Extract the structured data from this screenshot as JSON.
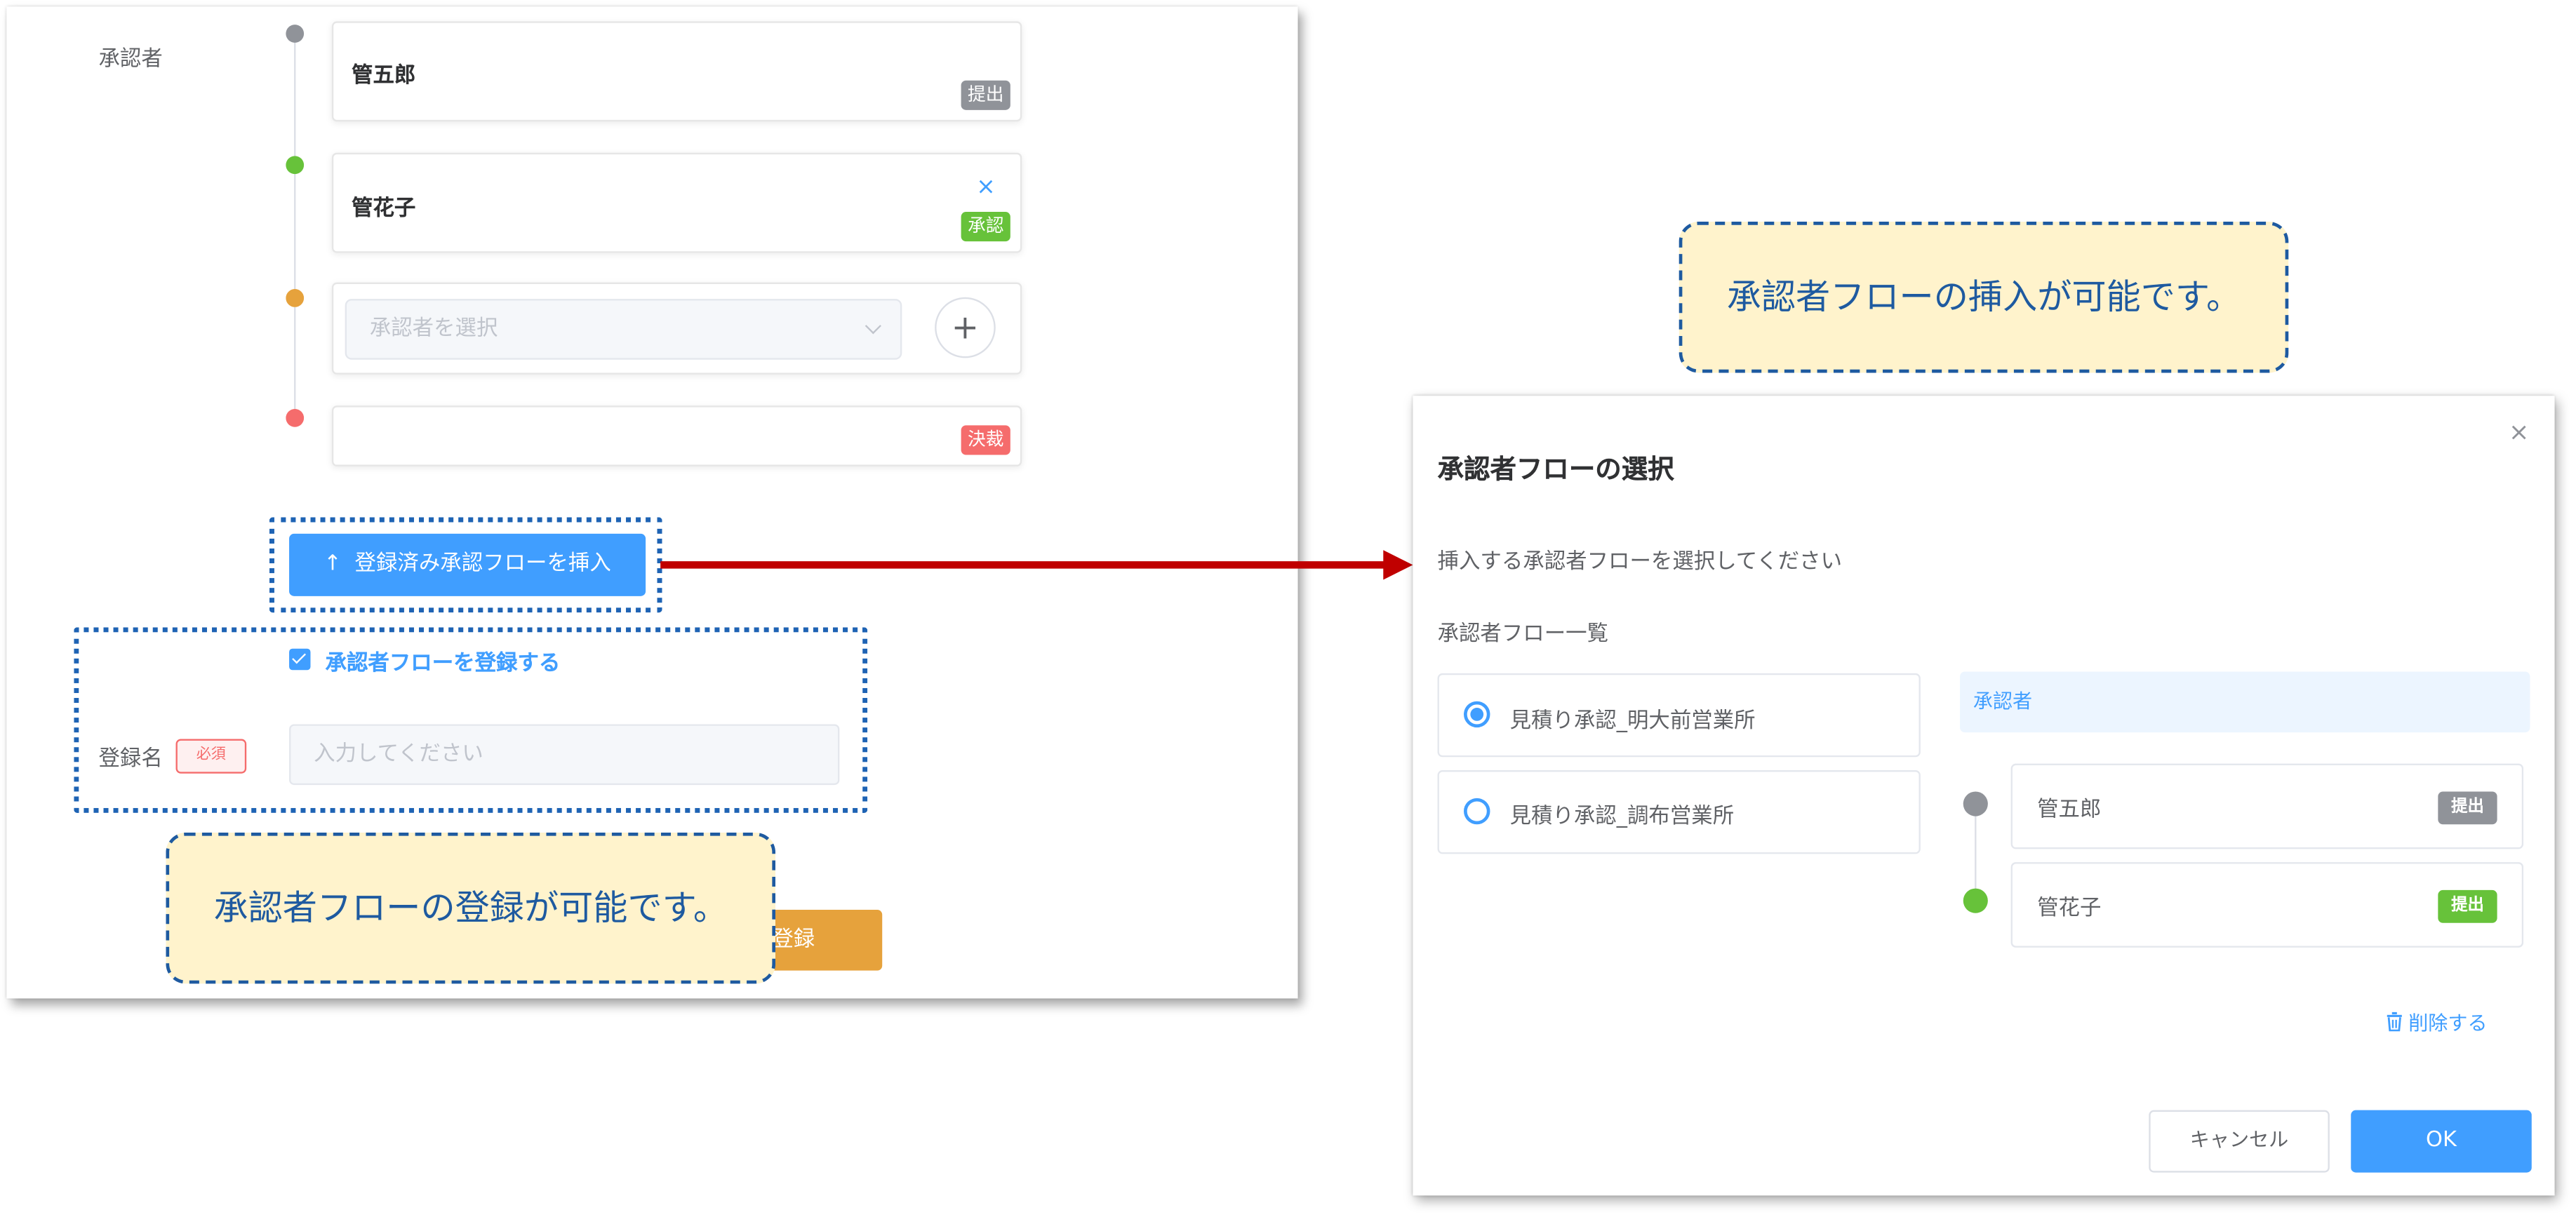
{
  "left_form": {
    "approver_label": "承認者",
    "approvers": [
      {
        "name": "管五郎",
        "tag": "提出",
        "tag_color": "#909399",
        "dot_color": "#909399"
      },
      {
        "name": "管花子",
        "tag": "承認",
        "tag_color": "#67c23a",
        "dot_color": "#67c23a",
        "remove_icon": "×"
      },
      {
        "select_placeholder": "承認者を選択",
        "add_icon": "+",
        "dot_color": "#e6a23c"
      },
      {
        "tag": "決裁",
        "tag_color": "#f56c6c",
        "dot_color": "#f56c6c"
      }
    ],
    "insert_button": "登録済み承認フローを挿入",
    "insert_icon": "↑",
    "register_checkbox": "承認者フローを登録する",
    "register_name_label": "登録名",
    "required_tag": "必須",
    "register_name_placeholder": "入力してください",
    "submit_button_partial": "登録"
  },
  "callouts": {
    "register": "承認者フローの登録が可能です。",
    "insert": "承認者フローの挿入が可能です。"
  },
  "dialog": {
    "title": "承認者フローの選択",
    "close_icon": "×",
    "instruction": "挿入する承認者フローを選択してください",
    "list_label": "承認者フロー一覧",
    "flows": [
      {
        "label": "見積り承認_明大前営業所",
        "selected": true
      },
      {
        "label": "見積り承認_調布営業所",
        "selected": false
      }
    ],
    "approver_header": "承認者",
    "approvers": [
      {
        "name": "管五郎",
        "tag": "提出",
        "tag_color": "#909399",
        "dot_color": "#909399"
      },
      {
        "name": "管花子",
        "tag": "提出",
        "tag_color": "#67c23a",
        "dot_color": "#67c23a"
      }
    ],
    "delete_link": "削除する",
    "cancel_button": "キャンセル",
    "ok_button": "OK"
  },
  "colors": {
    "primary": "#409eff",
    "arrow": "#c00000",
    "callout_border": "#1e5aa0",
    "callout_fill": "#fff3cc"
  }
}
